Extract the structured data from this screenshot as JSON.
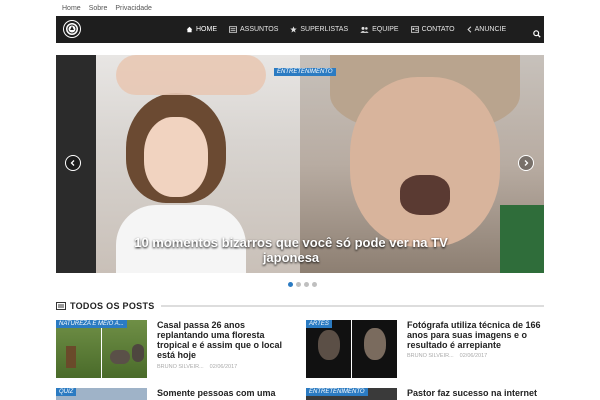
{
  "top_links": [
    "Home",
    "Sobre",
    "Privacidade"
  ],
  "nav": {
    "items": [
      {
        "label": "Home",
        "icon": "home-icon",
        "active": true
      },
      {
        "label": "Assuntos",
        "icon": "list-icon",
        "active": false
      },
      {
        "label": "Superlistas",
        "icon": "star-icon",
        "active": false
      },
      {
        "label": "Equipe",
        "icon": "users-icon",
        "active": false
      },
      {
        "label": "Contato",
        "icon": "contact-icon",
        "active": false
      },
      {
        "label": "Anuncie",
        "icon": "chevron-left-icon",
        "active": false
      }
    ]
  },
  "slider": {
    "category": "Entretenimento",
    "title": "10 momentos bizarros que você só pode ver na TV japonesa",
    "dots": 4,
    "active_dot": 0
  },
  "section": {
    "title": "TODOS OS POSTS"
  },
  "posts": [
    {
      "category": "NATUREZA E MEIO A...",
      "title": "Casal passa 26 anos replantando uma floresta tropical e é assim que o local está hoje",
      "author": "BRUNO SILVEIR...",
      "date": "02/06/2017"
    },
    {
      "category": "ARTES",
      "title": "Fotógrafa utiliza técnica de 166 anos para suas imagens e o resultado é arrepiante",
      "author": "BRUNO SILVEIR...",
      "date": "02/06/2017"
    },
    {
      "category": "QUIZ",
      "title": "Somente pessoas com uma"
    },
    {
      "category": "ENTRETENIMENTO",
      "title": "Pastor faz sucesso na internet"
    }
  ],
  "colors": {
    "accent": "#2b7bc2",
    "nav_bg": "#1e1e1e"
  }
}
